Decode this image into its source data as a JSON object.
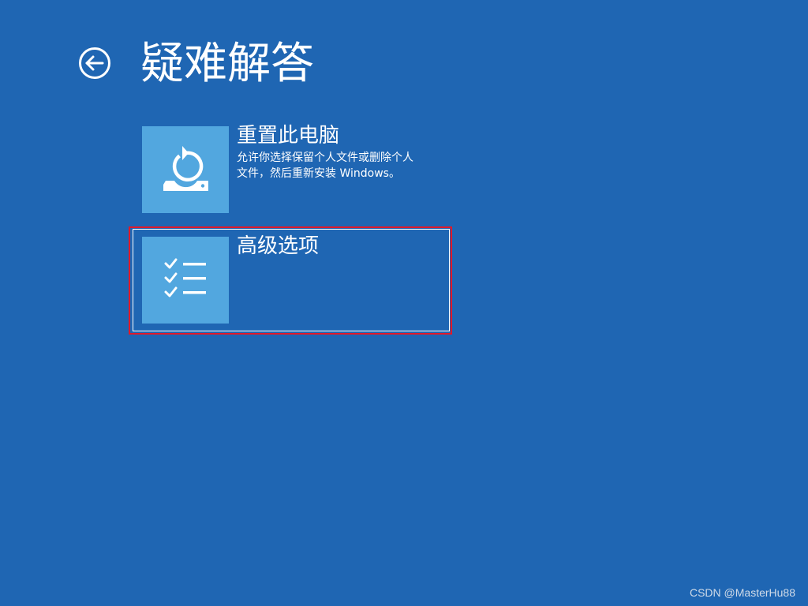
{
  "page": {
    "title": "疑难解答",
    "background_color": "#1f66b3",
    "back_icon": "back-arrow-circle-icon"
  },
  "options": [
    {
      "id": "reset",
      "title": "重置此电脑",
      "description_line1": "允许你选择保留个人文件或删除个人",
      "description_line2": "文件，然后重新安装 Windows。",
      "icon": "reset-pc-icon",
      "icon_background": "#52a7df"
    },
    {
      "id": "advanced",
      "title": "高级选项",
      "icon": "checklist-icon",
      "icon_background": "#52a7df",
      "focused": true
    }
  ],
  "annotation": {
    "highlight_color": "#e0192a"
  },
  "watermark": "CSDN @MasterHu88"
}
